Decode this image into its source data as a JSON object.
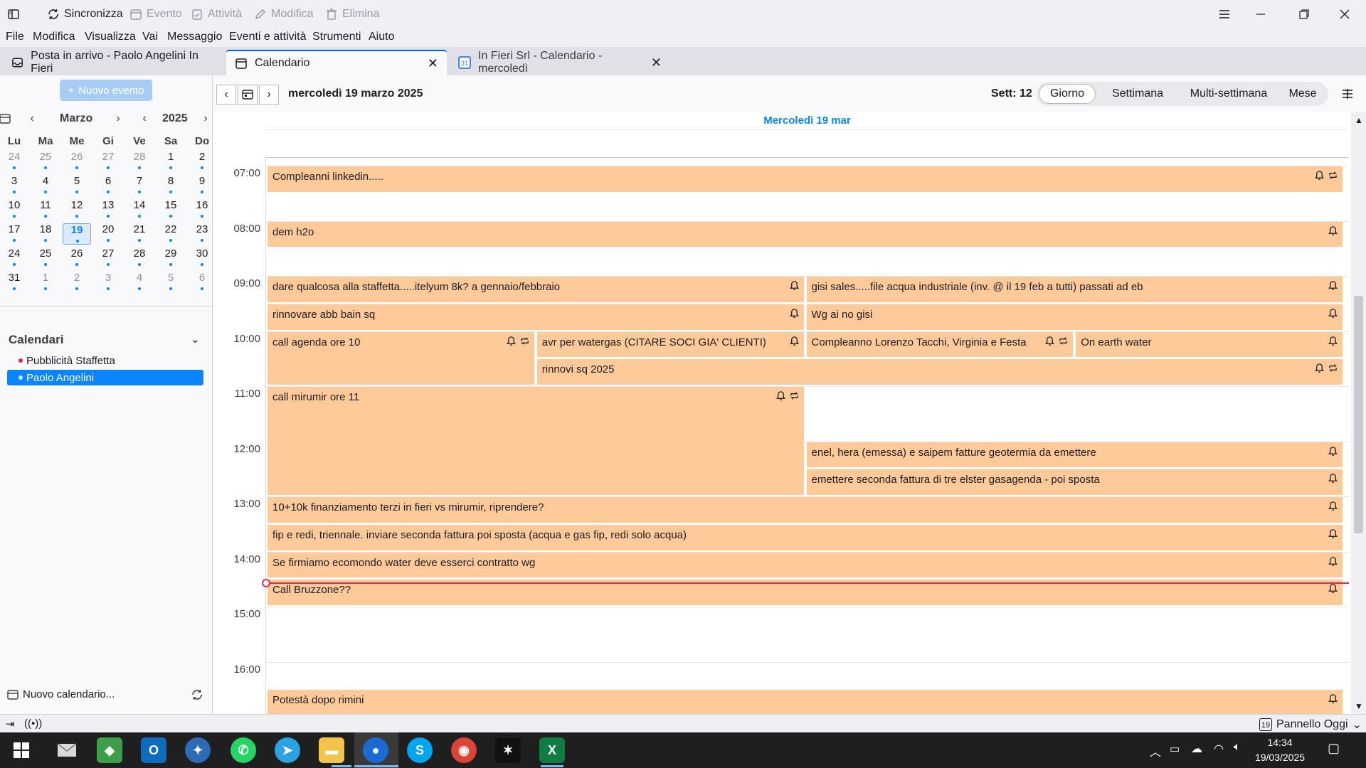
{
  "toolbar": {
    "sync": "Sincronizza",
    "event": "Evento",
    "task": "Attività",
    "edit": "Modifica",
    "delete": "Elimina"
  },
  "menu": [
    "File",
    "Modifica",
    "Visualizza",
    "Vai",
    "Messaggio",
    "Eventi e attività",
    "Strumenti",
    "Aiuto"
  ],
  "tabs": [
    {
      "label": "Posta in arrivo - Paolo Angelini In Fieri"
    },
    {
      "label": "Calendario"
    },
    {
      "label": "In Fieri Srl - Calendario - mercoledì"
    }
  ],
  "sidebar": {
    "new_event": "Nuovo evento",
    "month": "Marzo",
    "year": "2025",
    "weekdays": [
      "Lu",
      "Ma",
      "Me",
      "Gi",
      "Ve",
      "Sa",
      "Do"
    ],
    "weeks": [
      [
        "24",
        "25",
        "26",
        "27",
        "28",
        "1",
        "2"
      ],
      [
        "3",
        "4",
        "5",
        "6",
        "7",
        "8",
        "9"
      ],
      [
        "10",
        "11",
        "12",
        "13",
        "14",
        "15",
        "16"
      ],
      [
        "17",
        "18",
        "19",
        "20",
        "21",
        "22",
        "23"
      ],
      [
        "24",
        "25",
        "26",
        "27",
        "28",
        "29",
        "30"
      ],
      [
        "31",
        "1",
        "2",
        "3",
        "4",
        "5",
        "6"
      ]
    ],
    "calendars_title": "Calendari",
    "calendars": [
      {
        "name": "Pubblicità Staffetta",
        "color": "#e22850"
      },
      {
        "name": "Paolo Angelini",
        "color": "#9fc7f5"
      }
    ],
    "new_calendar": "Nuovo calendario..."
  },
  "main": {
    "date_title": "mercoledì 19 marzo 2025",
    "week_label": "Sett: 12",
    "views": [
      "Giorno",
      "Settimana",
      "Multi-settimana",
      "Mese"
    ],
    "active_view": "Giorno",
    "day_header": "Mercoledì 19 mar",
    "hours": [
      "07:00",
      "08:00",
      "09:00",
      "10:00",
      "11:00",
      "12:00",
      "13:00",
      "14:00",
      "15:00",
      "16:00"
    ],
    "now_time": "14:34",
    "events": [
      {
        "title": "Compleanni linkedin.....",
        "start": "07:00",
        "end": "07:30",
        "col": 0,
        "cols": 1,
        "icons": [
          "bell",
          "repeat"
        ]
      },
      {
        "title": "dem h2o",
        "start": "08:00",
        "end": "08:30",
        "col": 0,
        "cols": 1,
        "icons": [
          "bell"
        ]
      },
      {
        "title": "dare qualcosa alla staffetta.....itelyum 8k? a gennaio/febbraio",
        "start": "09:00",
        "end": "09:30",
        "col": 0,
        "cols": 2,
        "icons": [
          "bell"
        ]
      },
      {
        "title": "gisi sales.....file acqua industriale (inv. @ il 19 feb a tutti) passati ad eb",
        "start": "09:00",
        "end": "09:30",
        "col": 1,
        "cols": 2,
        "icons": [
          "bell"
        ]
      },
      {
        "title": "rinnovare abb bain sq",
        "start": "09:30",
        "end": "10:00",
        "col": 0,
        "cols": 2,
        "icons": [
          "bell"
        ]
      },
      {
        "title": "Wg ai no gisi",
        "start": "09:30",
        "end": "10:00",
        "col": 1,
        "cols": 2,
        "icons": [
          "bell"
        ]
      },
      {
        "title": "call agenda ore 10",
        "start": "10:00",
        "end": "11:00",
        "col": 0,
        "cols": 4,
        "icons": [
          "bell",
          "repeat"
        ]
      },
      {
        "title": "avr per watergas (CITARE SOCI GIA' CLIENTI)",
        "start": "10:00",
        "end": "10:30",
        "col": 1,
        "cols": 4,
        "icons": [
          "bell"
        ]
      },
      {
        "title": "Compleanno Lorenzo Tacchi, Virginia e Festa",
        "start": "10:00",
        "end": "10:30",
        "col": 2,
        "cols": 4,
        "icons": [
          "bell",
          "repeat"
        ]
      },
      {
        "title": "On earth water",
        "start": "10:00",
        "end": "10:30",
        "col": 3,
        "cols": 4,
        "icons": [
          "bell"
        ]
      },
      {
        "title": "rinnovi sq 2025",
        "start": "10:30",
        "end": "11:00",
        "col": 1,
        "cols": 4,
        "span": 3,
        "icons": [
          "bell",
          "repeat"
        ]
      },
      {
        "title": "call mirumir ore 11",
        "start": "11:00",
        "end": "13:00",
        "col": 0,
        "cols": 2,
        "icons": [
          "bell",
          "repeat"
        ]
      },
      {
        "title": "enel, hera (emessa) e saipem fatture geotermia da emettere",
        "start": "12:00",
        "end": "12:30",
        "col": 1,
        "cols": 2,
        "icons": [
          "bell"
        ]
      },
      {
        "title": "emettere seconda fattura di tre elster gasagenda - poi sposta",
        "start": "12:30",
        "end": "13:00",
        "col": 1,
        "cols": 2,
        "icons": [
          "bell"
        ]
      },
      {
        "title": "10+10k finanziamento terzi in fieri vs mirumir, riprendere?",
        "start": "13:00",
        "end": "13:30",
        "col": 0,
        "cols": 1,
        "icons": [
          "bell"
        ]
      },
      {
        "title": "fip e redi, triennale. inviare seconda fattura poi sposta (acqua e gas fip, redi solo acqua)",
        "start": "13:30",
        "end": "14:00",
        "col": 0,
        "cols": 1,
        "icons": [
          "bell"
        ]
      },
      {
        "title": "Se firmiamo ecomondo water deve esserci contratto wg",
        "start": "14:00",
        "end": "14:30",
        "col": 0,
        "cols": 1,
        "icons": [
          "bell"
        ]
      },
      {
        "title": "Call Bruzzone??",
        "start": "14:30",
        "end": "15:00",
        "col": 0,
        "cols": 1,
        "icons": [
          "bell"
        ]
      },
      {
        "title": "Potestà dopo rimini",
        "start": "16:30",
        "end": "17:00",
        "col": 0,
        "cols": 1,
        "icons": [
          "bell"
        ]
      }
    ]
  },
  "status": {
    "today_pane": "Pannello Oggi",
    "today_icon_day": "19"
  },
  "taskbar": {
    "time": "14:34",
    "date": "19/03/2025"
  },
  "colors": {
    "accent": "#0a84ff",
    "event": "#ffca99",
    "now_line": "#e22850"
  }
}
